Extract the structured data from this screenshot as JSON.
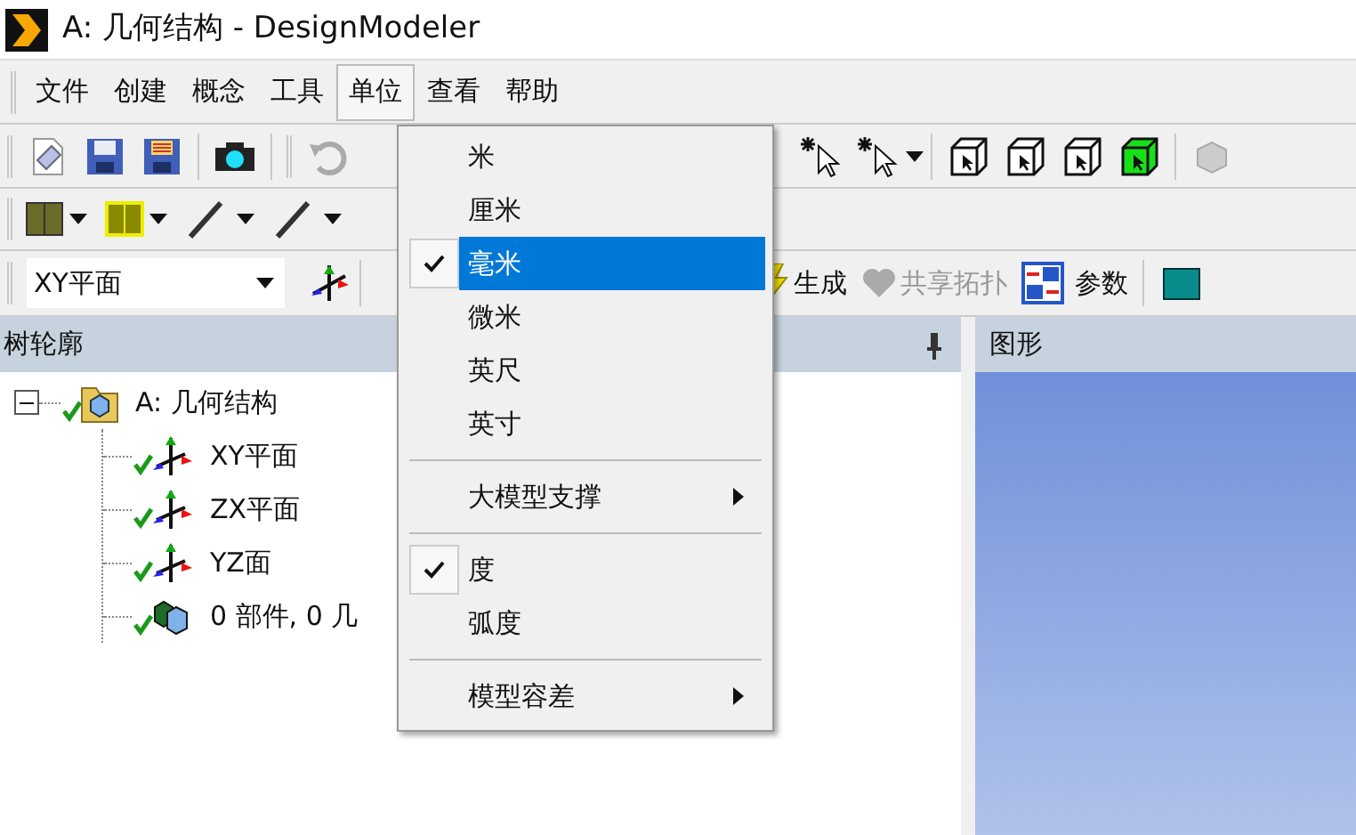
{
  "window": {
    "title": "A: 几何结构 - DesignModeler"
  },
  "menu_bar": [
    {
      "label": "文件",
      "selected": false
    },
    {
      "label": "创建",
      "selected": false
    },
    {
      "label": "概念",
      "selected": false
    },
    {
      "label": "工具",
      "selected": false
    },
    {
      "label": "单位",
      "selected": true
    },
    {
      "label": "查看",
      "selected": false
    },
    {
      "label": "帮助",
      "selected": false
    }
  ],
  "plane_combo": {
    "value": "XY平面"
  },
  "toolbar_buttons": [
    {
      "label": "生成",
      "disabled": false,
      "kind": "generate"
    },
    {
      "label": "共享拓扑",
      "disabled": true,
      "kind": "share"
    },
    {
      "label": "参数",
      "disabled": false,
      "kind": "parameters"
    }
  ],
  "tree_panel": {
    "title": "树轮廓",
    "tree": [
      {
        "label": "A: 几何结构",
        "expanded": true,
        "kind": "root",
        "children": [
          {
            "label": "XY平面",
            "kind": "plane"
          },
          {
            "label": "ZX平面",
            "kind": "plane"
          },
          {
            "label": "YZ面",
            "kind": "plane"
          },
          {
            "label": "0 部件, 0 几",
            "kind": "bodies"
          }
        ]
      }
    ]
  },
  "graphics_panel": {
    "title": "图形"
  },
  "units_menu": [
    {
      "kind": "item",
      "label": "米",
      "checked": false,
      "selected": false
    },
    {
      "kind": "item",
      "label": "厘米",
      "checked": false,
      "selected": false
    },
    {
      "kind": "item",
      "label": "毫米",
      "checked": true,
      "selected": true
    },
    {
      "kind": "item",
      "label": "微米",
      "checked": false,
      "selected": false
    },
    {
      "kind": "item",
      "label": "英尺",
      "checked": false,
      "selected": false
    },
    {
      "kind": "item",
      "label": "英寸",
      "checked": false,
      "selected": false
    },
    {
      "kind": "separator"
    },
    {
      "kind": "submenu",
      "label": "大模型支撑",
      "checked": false,
      "selected": false
    },
    {
      "kind": "separator"
    },
    {
      "kind": "item",
      "label": "度",
      "checked": true,
      "selected": false
    },
    {
      "kind": "item",
      "label": "弧度",
      "checked": false,
      "selected": false
    },
    {
      "kind": "separator"
    },
    {
      "kind": "submenu",
      "label": "模型容差",
      "checked": false,
      "selected": false
    }
  ]
}
